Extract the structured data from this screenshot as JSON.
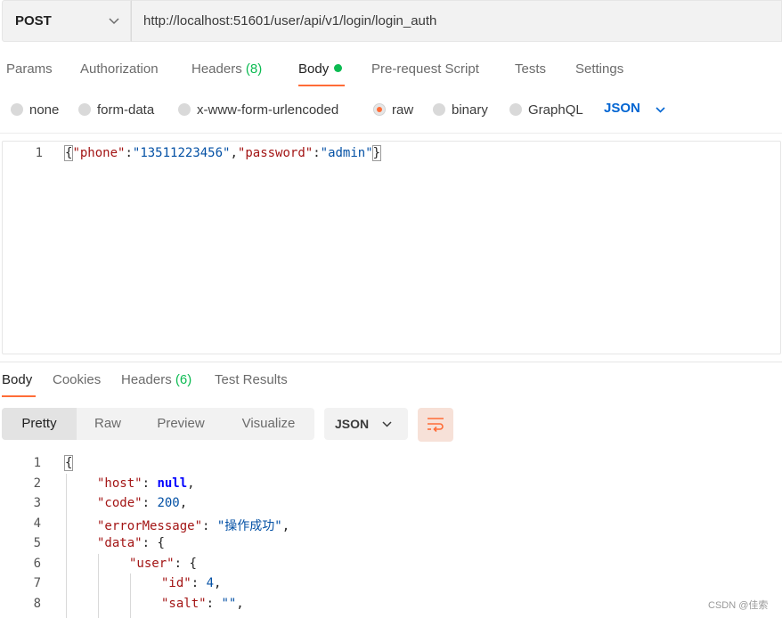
{
  "request": {
    "method": "POST",
    "url": "http://localhost:51601/user/api/v1/login/login_auth"
  },
  "request_tabs": [
    {
      "label": "Params"
    },
    {
      "label": "Authorization"
    },
    {
      "label": "Headers",
      "count": "(8)"
    },
    {
      "label": "Body"
    },
    {
      "label": "Pre-request Script"
    },
    {
      "label": "Tests"
    },
    {
      "label": "Settings"
    }
  ],
  "body_types": [
    "none",
    "form-data",
    "x-www-form-urlencoded",
    "raw",
    "binary",
    "GraphQL"
  ],
  "body_format": "JSON",
  "request_body": {
    "line_number": "1",
    "open": "{",
    "k1": "\"phone\"",
    "colon1": ":",
    "v1": "\"13511223456\"",
    "comma1": ",",
    "k2": "\"password\"",
    "colon2": ":",
    "v2": "\"admin\"",
    "close": "}"
  },
  "response_tabs": [
    {
      "label": "Body"
    },
    {
      "label": "Cookies"
    },
    {
      "label": "Headers",
      "count": "(6)"
    },
    {
      "label": "Test Results"
    }
  ],
  "view_modes": [
    "Pretty",
    "Raw",
    "Preview",
    "Visualize"
  ],
  "response_format": "JSON",
  "response_lines": {
    "numbers": [
      "1",
      "2",
      "3",
      "4",
      "5",
      "6",
      "7",
      "8"
    ],
    "l1_open": "{",
    "l2_key": "\"host\"",
    "l2_sep": ": ",
    "l2_val": "null",
    "l2_end": ",",
    "l3_key": "\"code\"",
    "l3_sep": ": ",
    "l3_val": "200",
    "l3_end": ",",
    "l4_key": "\"errorMessage\"",
    "l4_sep": ": ",
    "l4_val": "\"操作成功\"",
    "l4_end": ",",
    "l5_key": "\"data\"",
    "l5_sep": ": ",
    "l5_val": "{",
    "l6_key": "\"user\"",
    "l6_sep": ": ",
    "l6_val": "{",
    "l7_key": "\"id\"",
    "l7_sep": ": ",
    "l7_val": "4",
    "l7_end": ",",
    "l8_key": "\"salt\"",
    "l8_sep": ": ",
    "l8_val": "\"\"",
    "l8_end": ","
  },
  "watermark": "CSDN @佳索",
  "colors": {
    "accent": "#ff6c37",
    "count": "#0cbb52",
    "json_select": "#0265d2"
  },
  "icons": [
    "chevron-down-icon",
    "wrap-lines-icon"
  ]
}
